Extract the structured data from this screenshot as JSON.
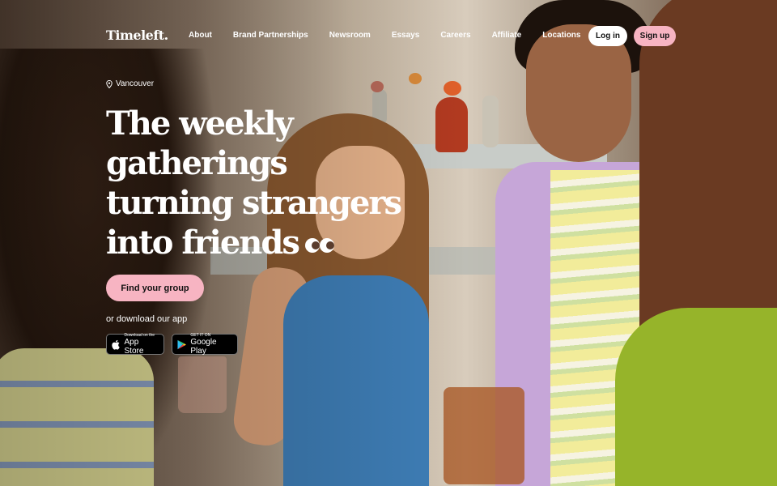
{
  "header": {
    "logo": "Timeleft.",
    "nav": [
      "About",
      "Brand Partnerships",
      "Newsroom",
      "Essays",
      "Careers",
      "Affiliate",
      "Locations"
    ],
    "login_label": "Log in",
    "signup_label": "Sign up"
  },
  "hero": {
    "location": "Vancouver",
    "headline": [
      "The weekly",
      "gatherings",
      "turning strangers",
      "into friends"
    ],
    "cta_label": "Find your group",
    "download_text": "or download our app",
    "app_store": {
      "small": "Download on the",
      "big": "App Store"
    },
    "google_play": {
      "small": "GET IT ON",
      "big": "Google Play"
    }
  },
  "colors": {
    "accent_pink": "#f7b4c2",
    "text": "#ffffff"
  },
  "icons": [
    "location-pin-icon",
    "infinity-cc-icon",
    "apple-icon",
    "google-play-icon"
  ]
}
